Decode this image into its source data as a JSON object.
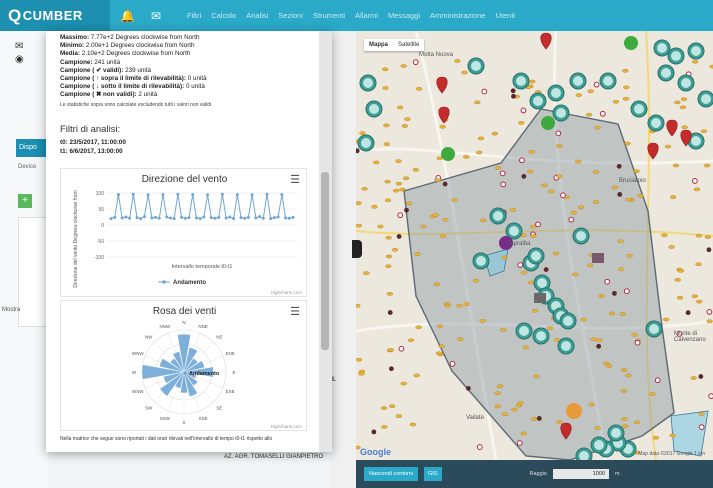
{
  "nav": {
    "logo": "CUMBER",
    "menu": [
      "Filtri",
      "Calcolo",
      "Analisi",
      "Sezioni",
      "Strumenti",
      "Allarmi",
      "Messaggi",
      "Amministrazione",
      "Utenti"
    ]
  },
  "sidebar": {
    "tab_label": "Dispo",
    "device_label": "Device",
    "mostra": "Mostra"
  },
  "stats": {
    "lines": [
      {
        "bold": "Massimo:",
        "text": " 7.77e+2 Degrees clockwise from North"
      },
      {
        "bold": "Minimo:",
        "text": " 2.00e+1 Degrees clockwise from North"
      },
      {
        "bold": "Media:",
        "text": " 2.10e+2 Degrees clockwise from North"
      },
      {
        "bold": "Campione:",
        "text": " 241 unità"
      },
      {
        "bold": "Campione ( ✔ validi):",
        "text": " 239 unità"
      },
      {
        "bold": "Campione ( ↑ sopra il limite di rilevabilità):",
        "text": " 0 unità"
      },
      {
        "bold": "Campione ( ↓ sotto il limite di rilevabilità):",
        "text": " 0 unità"
      },
      {
        "bold": "Campione ( ✖ non validi):",
        "text": " 2 unità"
      }
    ],
    "note": "Le statistiche sopra sono calcolate escludendo tutti i valori non validi"
  },
  "filters": {
    "title": "Filtri di analisi:",
    "t0": "t0: 23/5/2017, 11:00:00",
    "t1": "t1: 6/6/2017, 13:00:00"
  },
  "charts": {
    "line": {
      "title": "Direzione del vento",
      "xlabel": "Intervallo temporale t0-t1",
      "ylabel": "Direzione del vento Degrees clockwise from",
      "legend": "Andamento",
      "credits": "Highcharts.com",
      "ticks": [
        "100",
        "50",
        "0",
        "-50",
        "-100"
      ]
    },
    "rose": {
      "title": "Rosa dei venti",
      "legend": "Andamento",
      "credits": "Highcharts.com",
      "directions": [
        "N",
        "NNE",
        "NE",
        "ENE",
        "E",
        "ESE",
        "SE",
        "SSE",
        "S",
        "SSW",
        "SW",
        "WSW",
        "W",
        "WNW",
        "NW",
        "NNW"
      ]
    }
  },
  "bottom_note": "Nella matrice che segue sono riportati i dati orari rilevati nell'intervallo di tempo t0-t1 rispetto allo",
  "footer_label": "AZ. AGR. TOMASELLI GIANPIETRO",
  "footer_ml": "ML",
  "map": {
    "toggle": [
      "Mappa",
      "Satellite"
    ],
    "towns": [
      "Motta Nuova",
      "Bruciatoio",
      "Capralba",
      "Monte di Calvenzano",
      "Vailate"
    ],
    "google": "Google",
    "copyright": "Map data ©2017 Google   1 km"
  },
  "mapbar": {
    "btn1": "Nascondi contorni",
    "btn2": "GIS",
    "radius_label": "Raggio",
    "radius_value": "1000",
    "unit": "m"
  },
  "chart_data": [
    {
      "type": "line",
      "title": "Direzione del vento",
      "xlabel": "Intervallo temporale t0-t1",
      "ylabel": "Direzione del vento Degrees clockwise from North",
      "ylim": [
        -100,
        100
      ],
      "series": [
        {
          "name": "Andamento",
          "values": [
            20,
            24,
            95,
            22,
            25,
            21,
            96,
            23,
            20,
            26,
            94,
            22,
            24,
            21,
            95,
            25,
            22,
            20,
            96,
            24,
            21,
            23,
            95,
            22,
            20,
            25,
            94,
            23,
            21,
            24,
            96,
            22,
            25,
            20,
            95,
            23,
            21,
            24,
            94,
            22,
            26,
            21,
            96,
            20,
            23,
            25,
            95,
            22,
            21,
            24
          ]
        }
      ]
    },
    {
      "type": "bar",
      "title": "Rosa dei venti",
      "categories": [
        "N",
        "NNE",
        "NE",
        "ENE",
        "E",
        "ESE",
        "SE",
        "SSE",
        "S",
        "SSW",
        "SW",
        "WSW",
        "W",
        "WNW",
        "NW",
        "NNW"
      ],
      "series": [
        {
          "name": "Andamento",
          "values": [
            9,
            6,
            4,
            5,
            7,
            3,
            4,
            6,
            5,
            4,
            7,
            5,
            10,
            6,
            4,
            5
          ]
        }
      ]
    }
  ]
}
